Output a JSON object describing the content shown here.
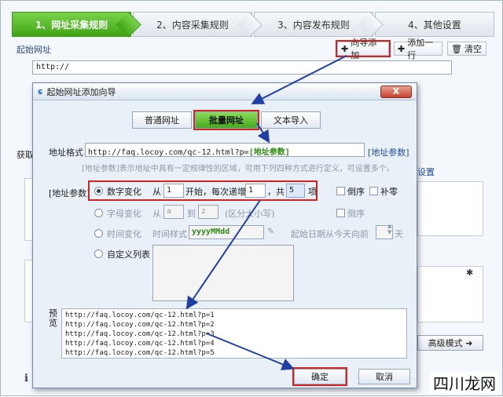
{
  "steps": [
    "1、网址采集规则",
    "2、内容采集规则",
    "3、内容发布规则",
    "4、其他设置"
  ],
  "top": {
    "start_url_label": "起始网址",
    "wizard_add": "向导添加",
    "add_line": "添加一行",
    "clear": "清空",
    "url_value": "http://",
    "get_label": "获取",
    "advanced_mode": "高级模式",
    "settings_link": "设置"
  },
  "dialog": {
    "title": "起始网址添加向导",
    "close": "X",
    "tabs": [
      "普通网址",
      "批量网址",
      "文本导入"
    ],
    "address_format_label": "地址格式",
    "address_format_value": "http://faq.locoy.com/qc-12.html?p=",
    "address_param_token": "[地址参数]",
    "address_param_link": "[地址参数]",
    "hint": "[地址参数]表示地址中具有一定规律性的区域，可用下列四种方式进行定义，可设置多个。",
    "param_label": "[地址参数]",
    "numeric": {
      "label": "数字变化",
      "from": "从",
      "start_value": "1",
      "start": "开始，每次递增",
      "step_value": "1",
      "total": "，共",
      "count_value": "5",
      "unit": "项",
      "reverse": "倒序",
      "zero_pad": "补零"
    },
    "letter": {
      "label": "字母变化",
      "from": "从",
      "from_value": "a",
      "to": "到",
      "to_value": "z",
      "case_note": "(区分大小写)",
      "reverse": "倒序"
    },
    "time": {
      "label": "时间变化",
      "style_label": "时间样式",
      "style_value": "yyyyMMdd",
      "start_date": "起始日期从今天向前",
      "days_value": "",
      "day": "天"
    },
    "custom": {
      "label": "自定义列表"
    },
    "preview_label": "预览",
    "preview_lines": [
      "http://faq.locoy.com/qc-12.html?p=1",
      "http://faq.locoy.com/qc-12.html?p=2",
      "http://faq.locoy.com/qc-12.html?p=3",
      "http://faq.locoy.com/qc-12.html?p=4",
      "http://faq.locoy.com/qc-12.html?p=5"
    ],
    "ok": "确定",
    "cancel": "取消"
  },
  "watermark": "四川龙网",
  "colors": {
    "accent_green": "#44a91b",
    "highlight_red": "#d12323",
    "arrow_blue": "#1f3fa6"
  }
}
